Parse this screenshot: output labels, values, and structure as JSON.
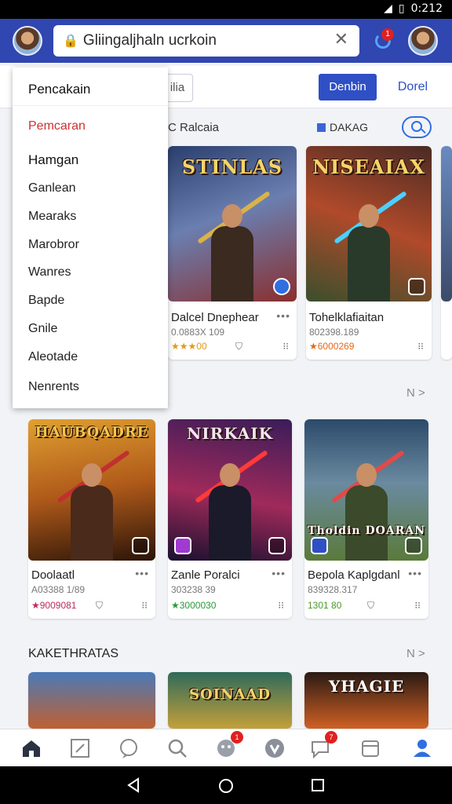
{
  "status": {
    "time": "0:212"
  },
  "header": {
    "url_text": "Gliingaljhaln ucrkoin",
    "notification_count": "1"
  },
  "filters": {
    "chip": "ilia",
    "primary_button": "Denbin",
    "secondary_button": "Dorel"
  },
  "dropdown": {
    "title": "Pencakain",
    "items": [
      "Pemcaran",
      "Hamgan",
      "Ganlean",
      "Mearaks",
      "Marobror",
      "Wanres",
      "Bapde",
      "Gnile",
      "Aleotade",
      "Nenrents"
    ]
  },
  "section1": {
    "label": "C Ralcaia",
    "filter_label": "DAKAG",
    "more": "N >"
  },
  "row1": [
    {
      "art_title": "STINLAS",
      "name": "Dalcel Dnephear",
      "sub": "0.0883X 109",
      "rating": "★★★00",
      "colors": [
        "#2b3f6e",
        "#8a2e2e"
      ]
    },
    {
      "art_title": "NISEAIAX",
      "name": "Tohelklafiaitan",
      "sub": "802398.189",
      "rating": "★6000269",
      "colors": [
        "#4a2a24",
        "#3a4f2c"
      ]
    }
  ],
  "row2": [
    {
      "art_title": "HAUBQADRE",
      "name": "Doolaatl",
      "sub": "A03388 1/89",
      "rating": "★9009081",
      "colors": [
        "#8a4a16",
        "#e0a030"
      ]
    },
    {
      "art_title": "NIRKAIK",
      "name": "Zanle Poralci",
      "sub": "303238 39",
      "rating": "★3000030",
      "colors": [
        "#3a1c5a",
        "#a02a5a"
      ]
    },
    {
      "art_title": "Tholdin DOARAN",
      "name": "Bepola Kaplgdanl",
      "sub": "839328.317",
      "rating": "1301 80",
      "colors": [
        "#2c4a6a",
        "#5a7a3a"
      ]
    }
  ],
  "section3": {
    "label": "KAKETHRATAS",
    "more": "N >"
  },
  "row3": [
    {
      "colors": [
        "#4a7ab8",
        "#c06030"
      ]
    },
    {
      "art_title": "SOINAAD",
      "colors": [
        "#2f6a5a",
        "#c4a03a"
      ]
    },
    {
      "art_title": "YHAGIE",
      "colors": [
        "#2a1a14",
        "#d06024"
      ]
    }
  ],
  "bottom_nav": {
    "badge_a": "1",
    "badge_b": "7"
  }
}
